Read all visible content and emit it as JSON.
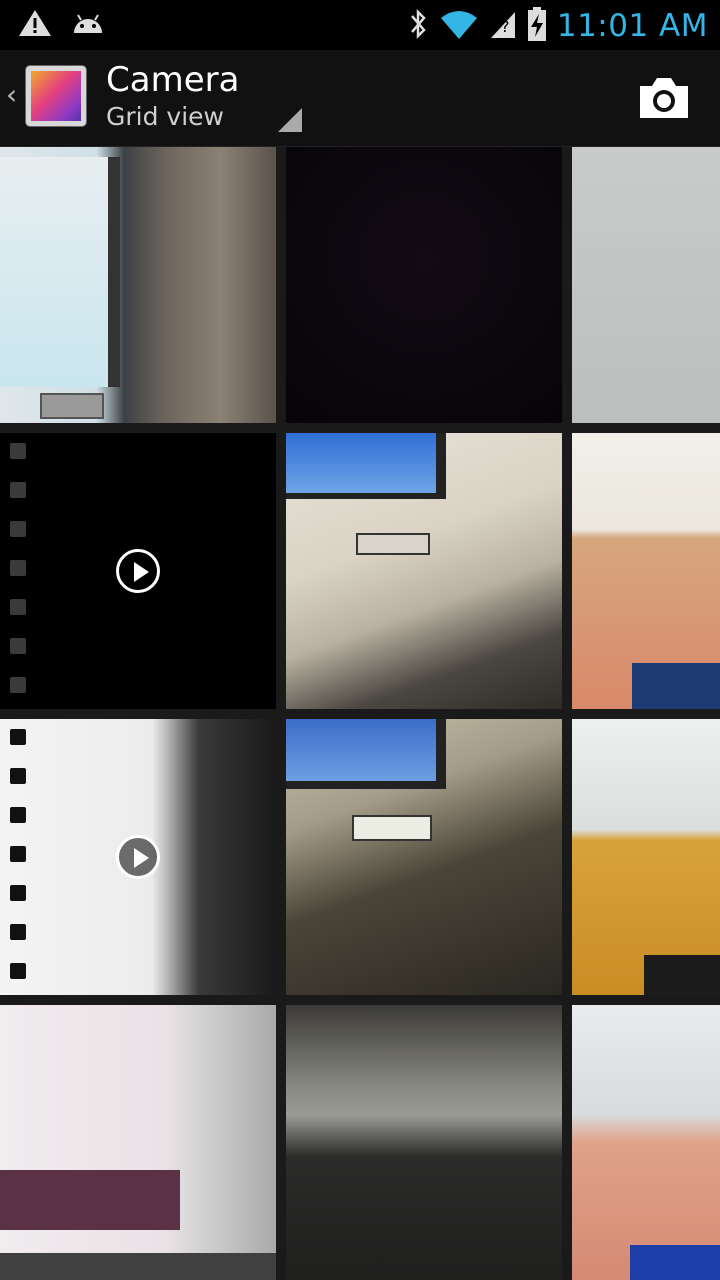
{
  "status_bar": {
    "time": "11:01 AM",
    "icons": [
      "warning-icon",
      "android-debug-icon",
      "bluetooth-icon",
      "wifi-icon",
      "no-signal-icon",
      "battery-charging-icon"
    ]
  },
  "action_bar": {
    "title": "Camera",
    "subtitle": "Grid view",
    "camera_action": "camera-icon",
    "accent_color": "#33b5e5"
  },
  "grid": {
    "items": [
      {
        "type": "photo",
        "description_icon": "photo-thumbnail"
      },
      {
        "type": "photo",
        "description_icon": "photo-thumbnail"
      },
      {
        "type": "photo",
        "description_icon": "photo-thumbnail"
      },
      {
        "type": "video",
        "description_icon": "video-thumbnail"
      },
      {
        "type": "photo",
        "description_icon": "photo-thumbnail"
      },
      {
        "type": "photo",
        "description_icon": "photo-thumbnail"
      },
      {
        "type": "video",
        "description_icon": "video-thumbnail"
      },
      {
        "type": "photo",
        "description_icon": "photo-thumbnail"
      },
      {
        "type": "photo",
        "description_icon": "photo-thumbnail"
      },
      {
        "type": "photo",
        "description_icon": "photo-thumbnail"
      },
      {
        "type": "photo",
        "description_icon": "photo-thumbnail"
      },
      {
        "type": "photo",
        "description_icon": "photo-thumbnail"
      }
    ]
  }
}
